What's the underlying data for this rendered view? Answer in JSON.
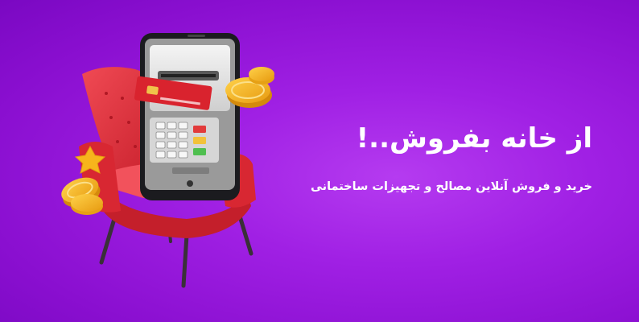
{
  "banner": {
    "headline": "از خانه بفروش..!",
    "subheadline": "خرید و فروش آنلاین مصالح و تجهیزات ساختمانی"
  },
  "colors": {
    "background": "#a020e4",
    "chair": "#e8343f",
    "coin": "#f7b51c",
    "card": "#d9232e",
    "text": "#ffffff"
  },
  "illustration": {
    "icons": [
      "armchair-icon",
      "smartphone-icon",
      "atm-card-slot-icon",
      "credit-card-icon",
      "keypad-icon",
      "coin-icon",
      "star-icon"
    ]
  }
}
